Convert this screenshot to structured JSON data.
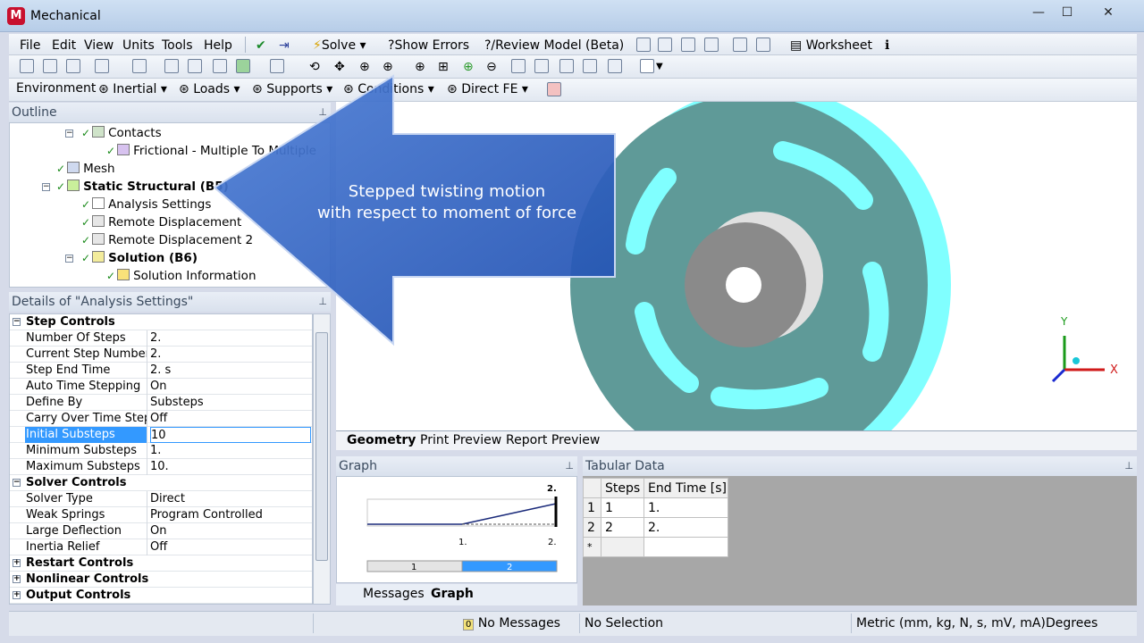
{
  "window": {
    "title": "Mechanical",
    "logo": "M",
    "controls": {
      "minimize": "—",
      "maximize": "☐",
      "close": "✕"
    }
  },
  "menubar": {
    "items": [
      "File",
      "Edit",
      "View",
      "Units",
      "Tools",
      "Help"
    ],
    "solve": "Solve",
    "show_errors": "Show Errors",
    "review_model": "Review Model (Beta)",
    "worksheet": "Worksheet"
  },
  "toolbar3": {
    "environment": "Environment",
    "inertial": "Inertial",
    "loads": "Loads",
    "supports": "Supports",
    "conditions": "Conditions",
    "direct_fe": "Direct FE"
  },
  "outline": {
    "title": "Outline",
    "items": [
      {
        "label": "Contacts"
      },
      {
        "label": "Frictional - Multiple To Multiple"
      },
      {
        "label": "Mesh"
      },
      {
        "label": "Static Structural (B5)"
      },
      {
        "label": "Analysis Settings"
      },
      {
        "label": "Remote Displacement"
      },
      {
        "label": "Remote Displacement 2"
      },
      {
        "label": "Solution (B6)"
      },
      {
        "label": "Solution Information"
      }
    ]
  },
  "details": {
    "title": "Details of \"Analysis Settings\"",
    "sections": {
      "step_controls": "Step Controls",
      "solver_controls": "Solver Controls",
      "restart_controls": "Restart Controls",
      "nonlinear_controls": "Nonlinear Controls",
      "output_controls": "Output Controls"
    },
    "rows": {
      "number_of_steps": {
        "label": "Number Of Steps",
        "value": "2."
      },
      "current_step": {
        "label": "Current Step Number",
        "value": "2."
      },
      "step_end_time": {
        "label": "Step End Time",
        "value": "2. s"
      },
      "auto_time": {
        "label": "Auto Time Stepping",
        "value": "On"
      },
      "define_by": {
        "label": "Define By",
        "value": "Substeps"
      },
      "carry_over": {
        "label": "Carry Over Time Step",
        "value": "Off"
      },
      "initial_substeps": {
        "label": "Initial Substeps",
        "value": "10"
      },
      "minimum_substeps": {
        "label": "Minimum Substeps",
        "value": "1."
      },
      "maximum_substeps": {
        "label": "Maximum Substeps",
        "value": "10."
      },
      "solver_type": {
        "label": "Solver Type",
        "value": "Direct"
      },
      "weak_springs": {
        "label": "Weak Springs",
        "value": "Program Controlled"
      },
      "large_deflection": {
        "label": "Large Deflection",
        "value": "On"
      },
      "inertia_relief": {
        "label": "Inertia Relief",
        "value": "Off"
      }
    }
  },
  "overlay": {
    "line1": "Stepped twisting motion",
    "line2": "with respect to moment of force"
  },
  "viewport": {
    "tabs": [
      "Geometry",
      "Print Preview",
      "Report Preview"
    ],
    "axis_y": "Y",
    "axis_x": "X",
    "colors": {
      "part": "#5f9a98",
      "part_light": "#80ffff",
      "hub": "#8a8a8a"
    }
  },
  "graph": {
    "title": "Graph",
    "step_label_top": "2.",
    "x_tick_1": "1.",
    "x_tick_2": "2.",
    "steps": [
      "1",
      "2"
    ],
    "tabs": [
      "Messages",
      "Graph"
    ]
  },
  "tabular": {
    "title": "Tabular Data",
    "headers": [
      "Steps",
      "End Time [s]"
    ],
    "rows": [
      {
        "index": "1",
        "steps": "1",
        "end": "1."
      },
      {
        "index": "2",
        "steps": "2",
        "end": "2."
      }
    ],
    "new_row": "*"
  },
  "statusbar": {
    "messages_count": "0",
    "messages": "No Messages",
    "selection": "No Selection",
    "units": "Metric (mm, kg, N, s, mV, mA)",
    "angle": "Degrees"
  }
}
